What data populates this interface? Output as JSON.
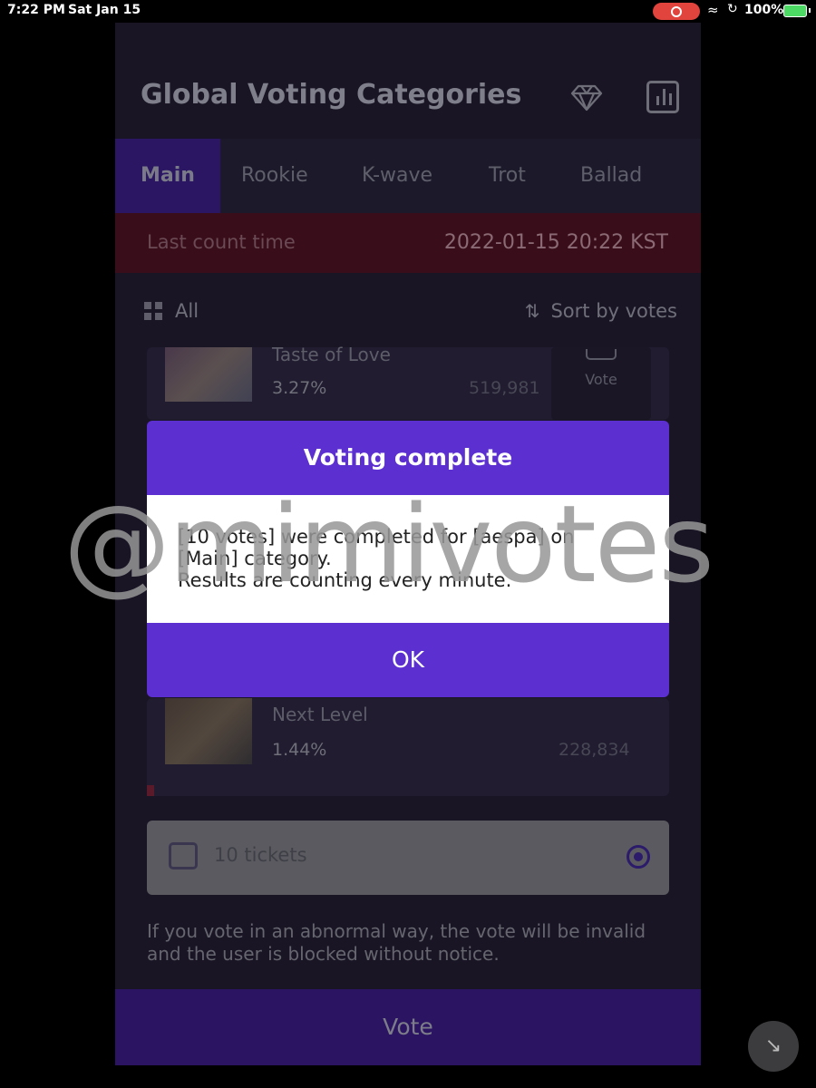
{
  "status_bar": {
    "time": "7:22 PM",
    "date": "Sat Jan 15",
    "battery": "100%"
  },
  "header": {
    "title": "Global Voting Categories",
    "icons": [
      "diamond-icon",
      "chart-icon"
    ]
  },
  "tabs": [
    "Main",
    "Rookie",
    "K-wave",
    "Trot",
    "Ballad"
  ],
  "count_bar": {
    "label": "Last count time",
    "time": "2022-01-15 20:22 KST"
  },
  "filter": {
    "all_label": "All",
    "sort_label": "Sort by votes"
  },
  "cards": [
    {
      "song": "Taste of Love",
      "percent": "3.27%",
      "votes": "519,981",
      "vote_label": "Vote"
    },
    {
      "song": "Next Level",
      "percent": "1.44%",
      "votes": "228,834"
    }
  ],
  "ticket": {
    "label": "10 tickets"
  },
  "notice": "If you vote in an abnormal way, the vote will be invalid and the user is blocked without notice.",
  "vote_button": "Vote",
  "dialog": {
    "title": "Voting complete",
    "line1": "[10 votes] were completed for [aespa] on",
    "line2": "[Main] category.",
    "line3": "Results are counting every minute.",
    "ok": "OK"
  },
  "watermark": "@mimivotes",
  "colors": {
    "accent": "#5b2fd0",
    "count_bar": "#3a0d1a",
    "panel": "#1a1525"
  }
}
